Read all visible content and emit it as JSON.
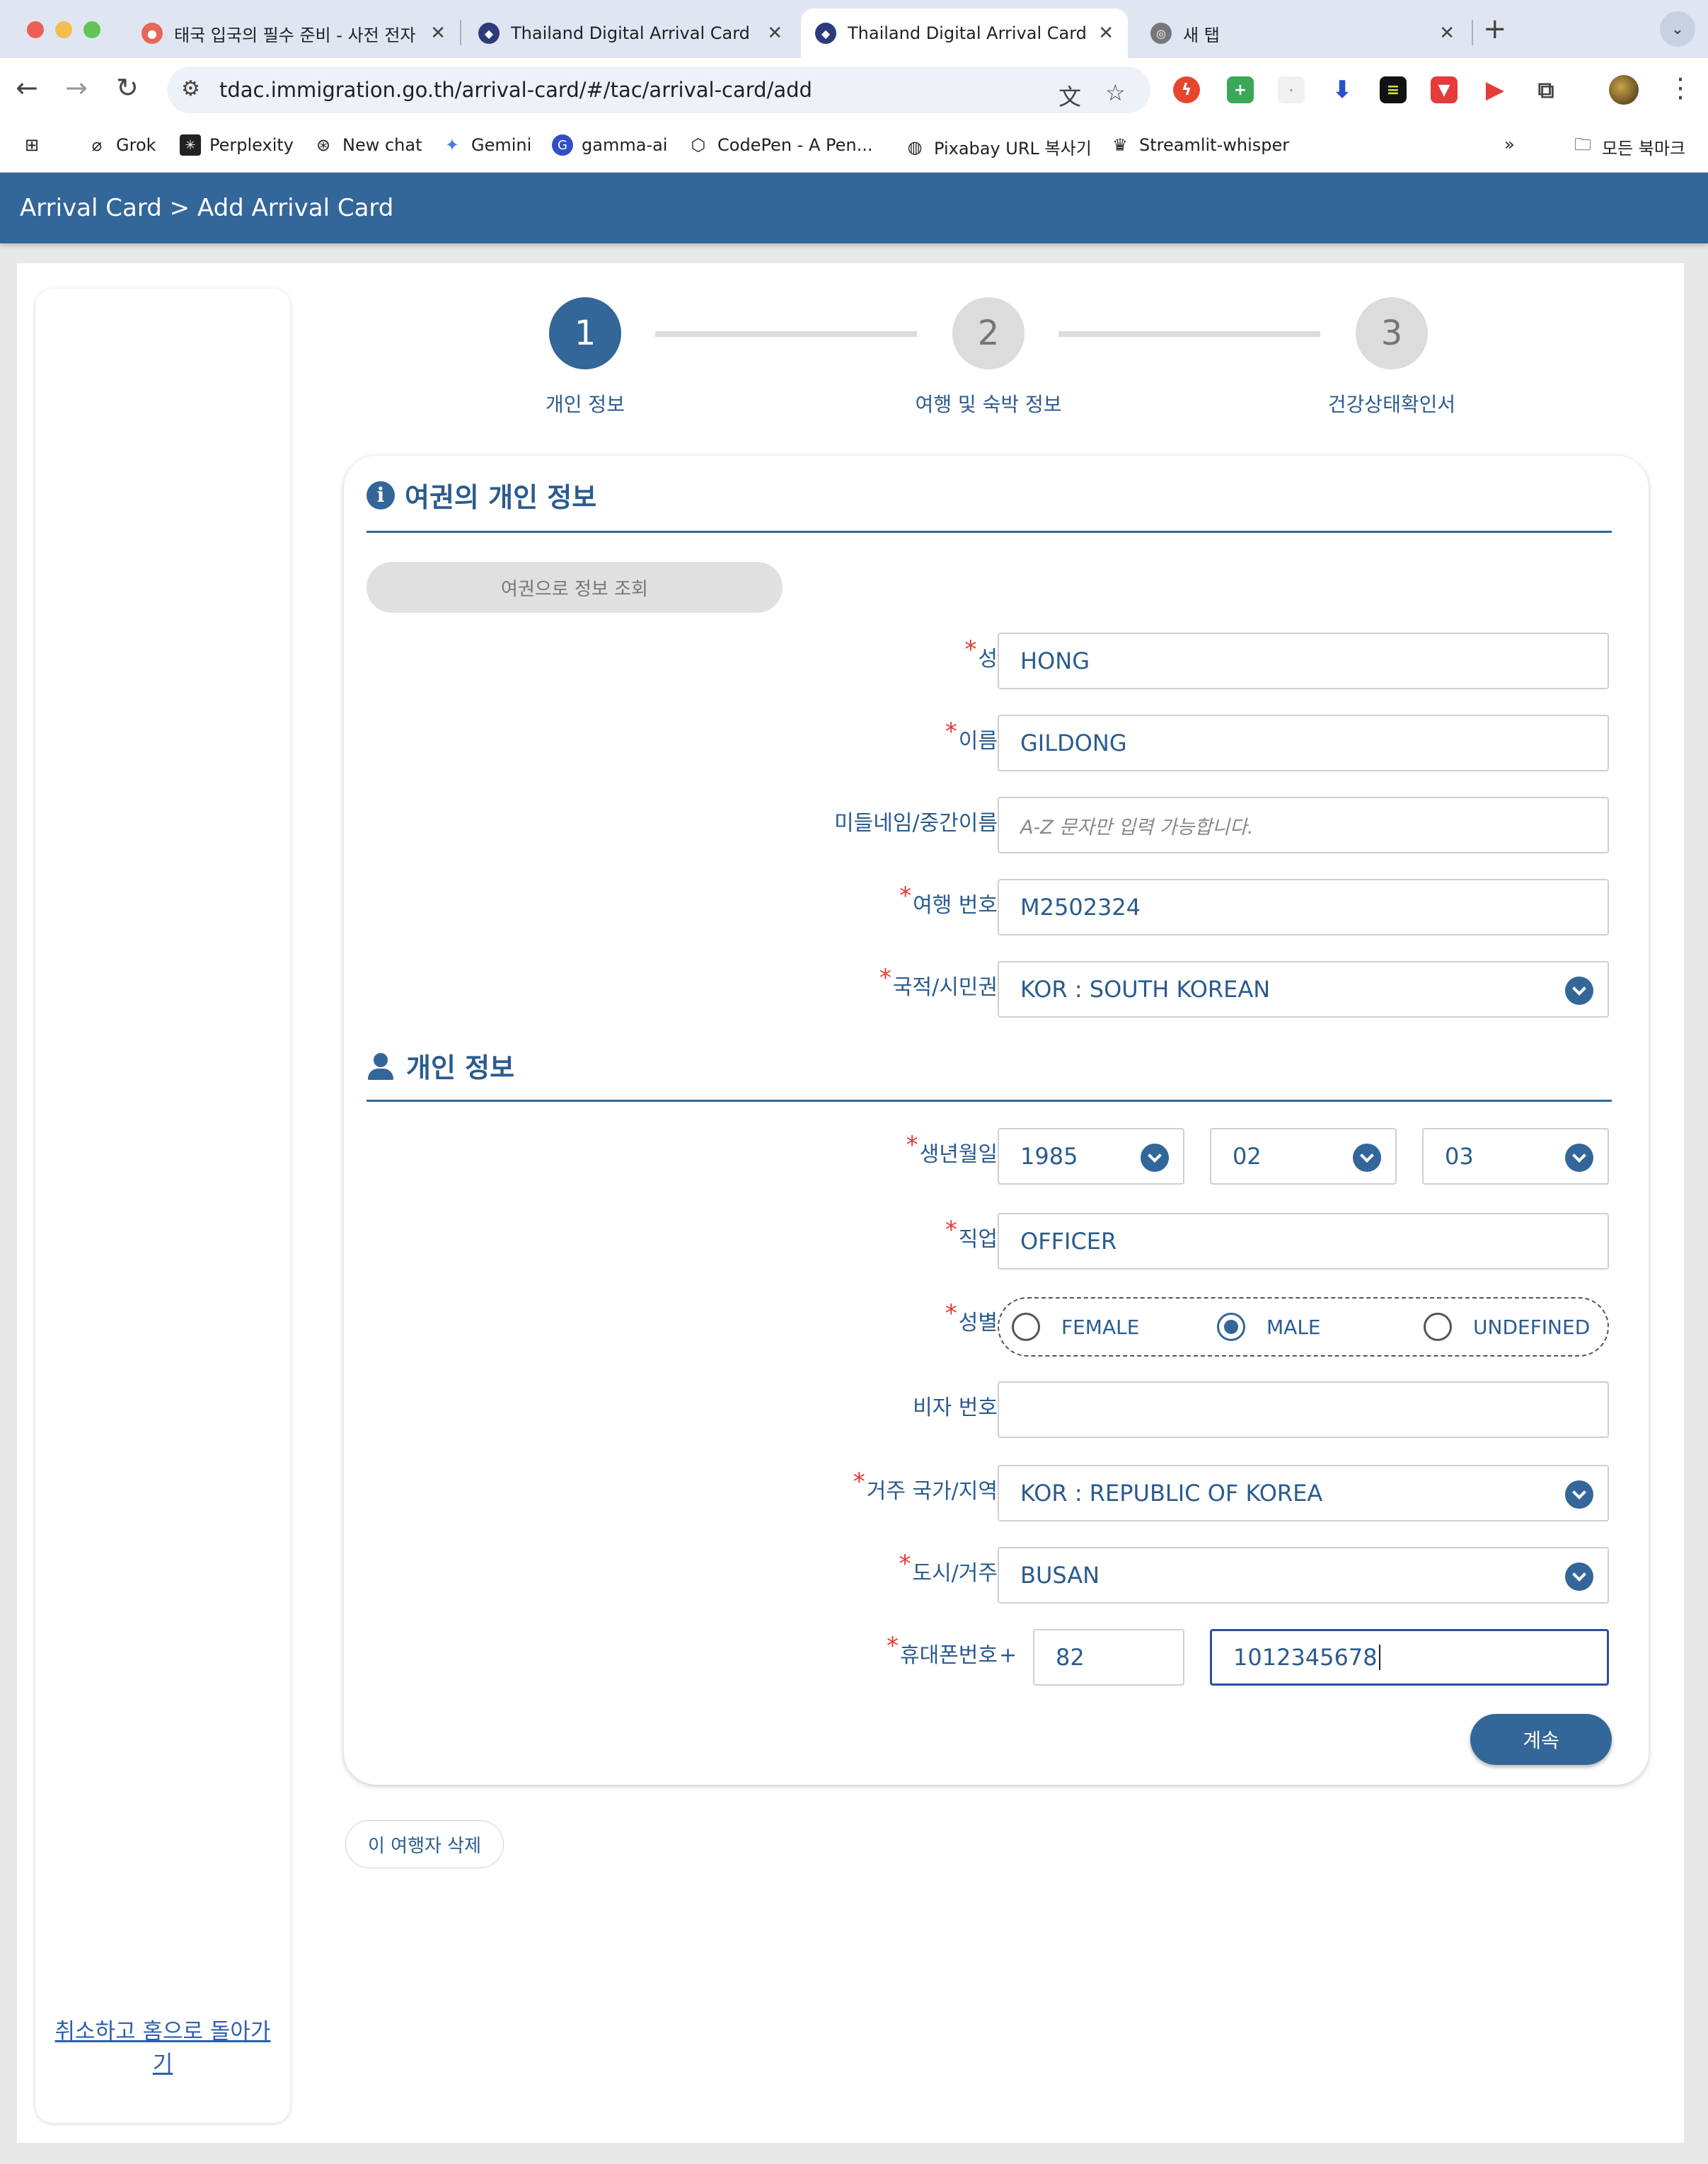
{
  "browser": {
    "tabs": [
      {
        "title": "태국 입국의 필수 준비 - 사전 전자",
        "active": false
      },
      {
        "title": "Thailand Digital Arrival Card",
        "active": false
      },
      {
        "title": "Thailand Digital Arrival Card",
        "active": true
      },
      {
        "title": "새 탭",
        "active": false
      }
    ],
    "url": "tdac.immigration.go.th/arrival-card/#/tac/arrival-card/add",
    "bookmarks": [
      "Grok",
      "Perplexity",
      "New chat",
      "Gemini",
      "gamma-ai",
      "CodePen - A Pen...",
      "Pixabay URL 복사기",
      "Streamlit-whisper"
    ],
    "all_bookmarks": "모든 북마크"
  },
  "header": {
    "breadcrumb": "Arrival Card > Add Arrival Card"
  },
  "sidebar": {
    "cancel_link": "취소하고 홈으로 돌아가기"
  },
  "stepper": {
    "steps": [
      {
        "number": "1",
        "label": "개인 정보",
        "active": true
      },
      {
        "number": "2",
        "label": "여행 및 숙박 정보",
        "active": false
      },
      {
        "number": "3",
        "label": "건강상태확인서",
        "active": false
      }
    ]
  },
  "passport_section": {
    "title": "여권의 개인 정보",
    "lookup_button": "여권으로 정보 조회",
    "fields": {
      "family_name": {
        "label": "성",
        "value": "HONG",
        "required": true
      },
      "first_name": {
        "label": "이름",
        "value": "GILDONG",
        "required": true
      },
      "middle_name": {
        "label": "미들네임/중간이름",
        "placeholder": "A-Z 문자만 입력 가능합니다.",
        "required": false
      },
      "passport_no": {
        "label": "여행 번호",
        "value": "M2502324",
        "required": true
      },
      "nationality": {
        "label": "국적/시민권",
        "value": "KOR : SOUTH KOREAN",
        "required": true
      }
    }
  },
  "personal_section": {
    "title": "개인 정보",
    "fields": {
      "birth_date": {
        "label": "생년월일",
        "year": "1985",
        "month": "02",
        "day": "03",
        "required": true
      },
      "occupation": {
        "label": "직업",
        "value": "OFFICER",
        "required": true
      },
      "gender": {
        "label": "성별",
        "options": [
          "FEMALE",
          "MALE",
          "UNDEFINED"
        ],
        "selected": "MALE",
        "required": true
      },
      "visa_no": {
        "label": "비자 번호",
        "value": "",
        "required": false
      },
      "residence_country": {
        "label": "거주 국가/지역",
        "value": "KOR : REPUBLIC OF KOREA",
        "required": true
      },
      "city": {
        "label": "도시/거주",
        "value": "BUSAN",
        "required": true
      },
      "phone": {
        "label": "휴대폰번호",
        "plus": "+",
        "country_code": "82",
        "number": "1012345678",
        "required": true
      }
    }
  },
  "actions": {
    "continue": "계속",
    "delete_traveler": "이 여행자 삭제"
  },
  "required_mark": "*"
}
